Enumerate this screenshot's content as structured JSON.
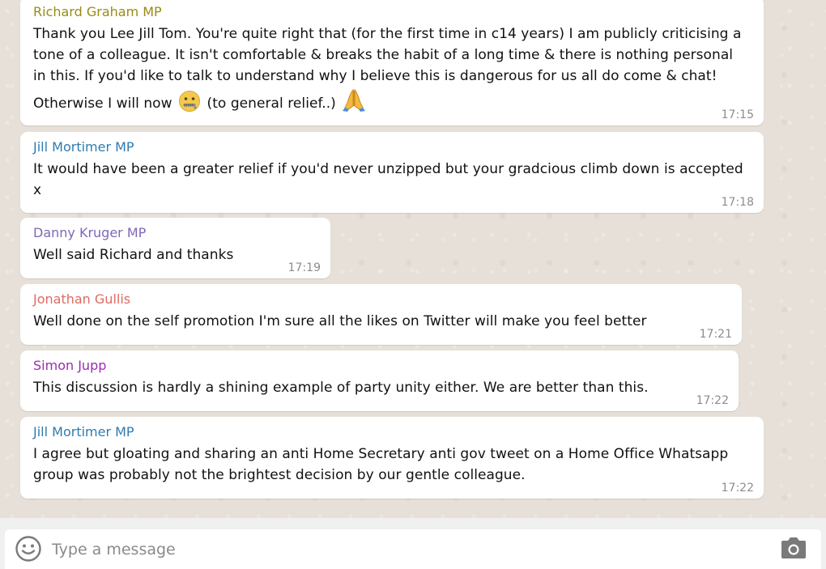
{
  "colors": {
    "richard": "#9a8b14",
    "jill": "#2f7bb0",
    "danny": "#7e68b8",
    "jonathan": "#e06a61",
    "simon": "#9c2cb2"
  },
  "messages": [
    {
      "sender": "Richard Graham MP",
      "text_main": "Thank you Lee Jill Tom. You're quite right that (for the first time in c14 years) I am publicly criticising a tone of a colleague. It isn't comfortable & breaks the habit of a long time & there is nothing personal in this. If you'd like to talk to understand why I believe this is dangerous for us all do come & chat! Otherwise I will now",
      "text_after_emoji": "(to general relief..)",
      "emojis": [
        "zipper-mouth-face",
        "folded-hands"
      ],
      "time": "17:15"
    },
    {
      "sender": "Jill Mortimer MP",
      "text": "It would have been a greater relief if you'd never unzipped but your gradcious climb down is accepted x",
      "time": "17:18"
    },
    {
      "sender": "Danny Kruger MP",
      "text": "Well said Richard and thanks",
      "time": "17:19"
    },
    {
      "sender": "Jonathan Gullis",
      "text": "Well done on the self promotion I'm sure all the likes on Twitter will make you feel better",
      "time": "17:21"
    },
    {
      "sender": "Simon Jupp",
      "text": "This discussion is hardly a shining example of party unity either. We are better than this.",
      "time": "17:22"
    },
    {
      "sender": "Jill Mortimer MP",
      "text": "I agree but gloating and sharing an anti Home Secretary anti gov tweet on a Home Office Whatsapp group was probably not the brightest decision by our gentle colleague.",
      "time": "17:22"
    }
  ],
  "composer": {
    "placeholder": "Type a message",
    "emoji_icon": "smiley-icon",
    "camera_icon": "camera-icon"
  }
}
